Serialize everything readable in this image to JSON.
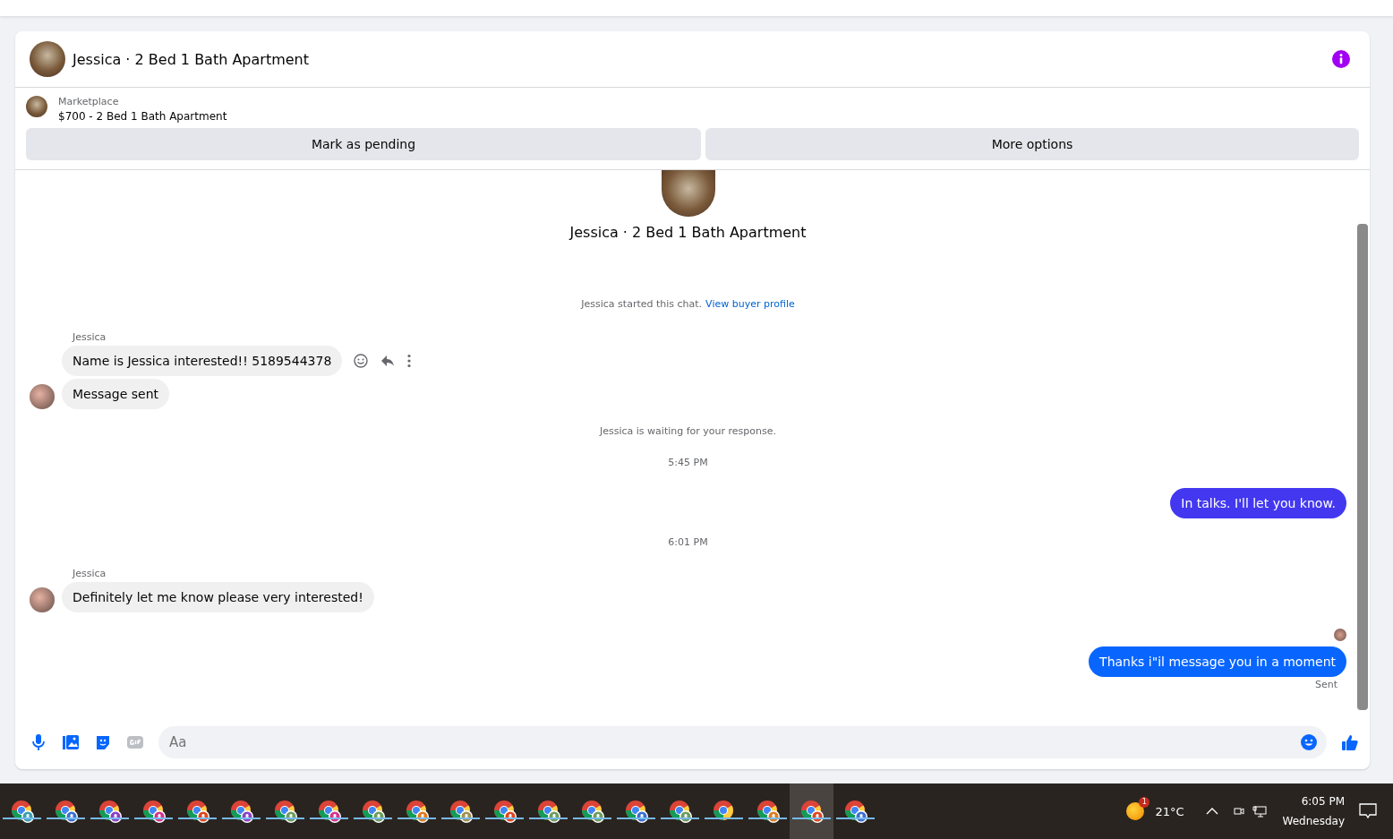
{
  "chat": {
    "title": "Jessica · 2 Bed 1 Bath Apartment"
  },
  "listing": {
    "source": "Marketplace",
    "summary": "$700 - 2 Bed 1 Bath Apartment"
  },
  "actions": [
    "Mark as pending",
    "More options"
  ],
  "intro": {
    "title": "Jessica · 2 Bed 1 Bath Apartment",
    "note": "Jessica started this chat.",
    "link": "View buyer profile"
  },
  "messages": [
    {
      "kind": "incoming",
      "sender": "Jessica",
      "texts": [
        "Name is Jessica interested!!  5189544378",
        "Message sent"
      ],
      "hovered": true
    },
    {
      "kind": "notice",
      "text": "Jessica is waiting for your response."
    },
    {
      "kind": "time",
      "text": "5:45 PM"
    },
    {
      "kind": "outgoing",
      "text": "In talks. I'll let you know.",
      "color": "#4338f0"
    },
    {
      "kind": "time",
      "text": "6:01 PM"
    },
    {
      "kind": "incoming",
      "sender": "Jessica",
      "texts": [
        "Definitely let me know please very interested!"
      ]
    },
    {
      "kind": "outgoing",
      "text": "Thanks i\"il message you in a moment",
      "color": "#0866ff",
      "status": "Sent",
      "seen": true
    }
  ],
  "composer": {
    "placeholder": "Aa"
  },
  "taskbar": {
    "apps": [
      {
        "color": "#3a9fb0",
        "active": false
      },
      {
        "color": "#3b6fd0",
        "active": false
      },
      {
        "color": "#8b3fc6",
        "active": false
      },
      {
        "color": "#d2348a",
        "active": false
      },
      {
        "color": "#e0451f",
        "active": false
      },
      {
        "color": "#8b3fc6",
        "active": false
      },
      {
        "color": "#6c9c5c",
        "active": false
      },
      {
        "color": "#d2348a",
        "active": false
      },
      {
        "color": "#6c9c5c",
        "active": false
      },
      {
        "color": "#e07b1f",
        "active": false
      },
      {
        "color": "#a09050",
        "active": false
      },
      {
        "color": "#e0451f",
        "active": false
      },
      {
        "color": "#6c9c5c",
        "active": false
      },
      {
        "color": "#6c9c5c",
        "active": false
      },
      {
        "color": "#3b6fd0",
        "active": false
      },
      {
        "color": "#6c9c5c",
        "active": false
      },
      {
        "active": false
      },
      {
        "color": "#e07b1f",
        "active": false
      },
      {
        "color": "#e0451f",
        "active": true
      },
      {
        "color": "#3b6fd0",
        "active": false
      }
    ],
    "weather": {
      "temp": "21°C",
      "badge": "1"
    },
    "time": "6:05 PM",
    "day": "Wednesday"
  }
}
